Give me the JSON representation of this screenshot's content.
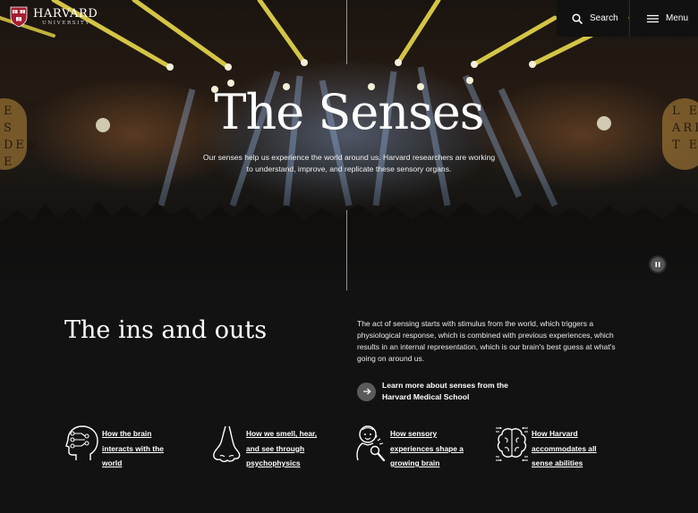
{
  "header": {
    "logo_name": "HARVARD",
    "logo_sub": "UNIVERSITY",
    "logo_icon": "harvard-shield-icon",
    "search_label": "Search",
    "menu_label": "Menu"
  },
  "hero": {
    "title": "The Senses",
    "subtitle": "Our senses help us experience the world around us. Harvard researchers are working to understand, improve, and replicate these sensory organs.",
    "pause_icon": "pause-icon"
  },
  "section": {
    "title": "The ins and outs",
    "body": "The act of sensing starts with stimulus from the world, which triggers a physiological response, which is combined with previous experiences, which results in an internal representation, which is our brain's best guess at what's going on around us.",
    "link_label": "Learn more about senses from the Harvard Medical School"
  },
  "cards": [
    {
      "label": "How the brain interacts with the world",
      "icon": "brain-head-icon"
    },
    {
      "label": "How we smell, hear, and see through psychophysics",
      "icon": "nose-icon"
    },
    {
      "label": "How sensory experiences shape a growing brain",
      "icon": "child-magnifier-icon"
    },
    {
      "label": "How Harvard accommodates all sense abilities",
      "icon": "circuit-brain-icon"
    }
  ],
  "colors": {
    "background": "#121212",
    "topbar": "#111111",
    "link_circle": "#5a5a5a",
    "harvard_crimson": "#a51c30"
  }
}
